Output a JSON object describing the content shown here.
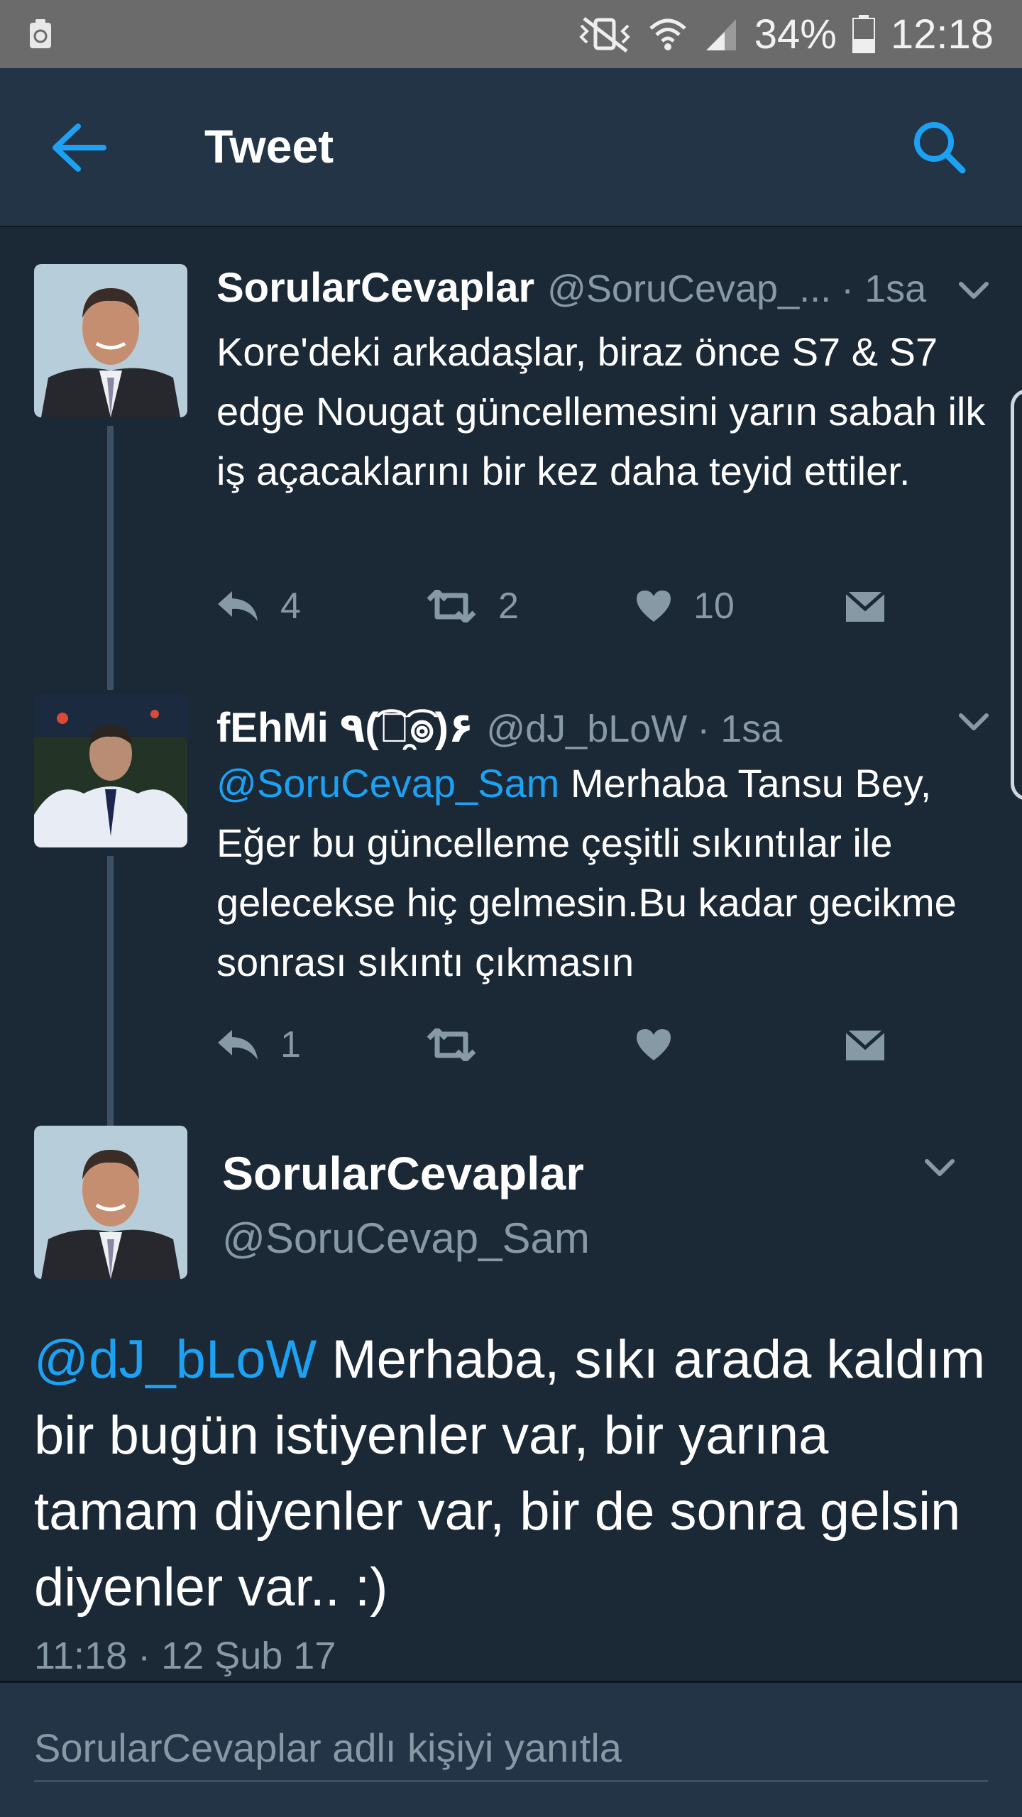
{
  "status_bar": {
    "battery": "34%",
    "time": "12:18",
    "icons": [
      "recycle-icon",
      "mute-vibrate-icon",
      "wifi-icon",
      "signal-icon",
      "battery-icon"
    ]
  },
  "header": {
    "title": "Tweet",
    "back_icon": "arrow-left-icon",
    "search_icon": "search-icon",
    "accent": "#1da1f2"
  },
  "thread": [
    {
      "name": "SorularCevaplar",
      "handle": "@SoruCevap_...",
      "time": "· 1sa",
      "text": "Kore'deki arkadaşlar, biraz önce S7 & S7 edge Nougat güncellemesini yarın sabah ilk iş açacaklarını bir kez daha teyid ettiler.",
      "counts": {
        "replies": "4",
        "retweets": "2",
        "likes": "10"
      }
    },
    {
      "name": "fEhMi ٩(͡๏̯͡๏)۶",
      "handle": "@dJ_bLoW",
      "time": "· 1sa",
      "mention": "@SoruCevap_Sam",
      "text": " Merhaba Tansu Bey, Eğer bu güncelleme çeşitli sıkıntılar ile gelecekse hiç gelmesin.Bu kadar gecikme sonrası sıkıntı çıkmasın",
      "counts": {
        "replies": "1",
        "retweets": "",
        "likes": ""
      }
    }
  ],
  "focused_tweet": {
    "name": "SorularCevaplar",
    "handle": "@SoruCevap_Sam",
    "mention": "@dJ_bLoW",
    "text": " Merhaba, sıkı arada kaldım bir bugün istiyenler var, bir yarına tamam diyenler var, bir de sonra gelsin diyenler var..  :)",
    "timestamp": "11:18 · 12 Şub 17"
  },
  "reply_bar": {
    "placeholder": "SorularCevaplar adlı kişiyi yanıtla"
  }
}
